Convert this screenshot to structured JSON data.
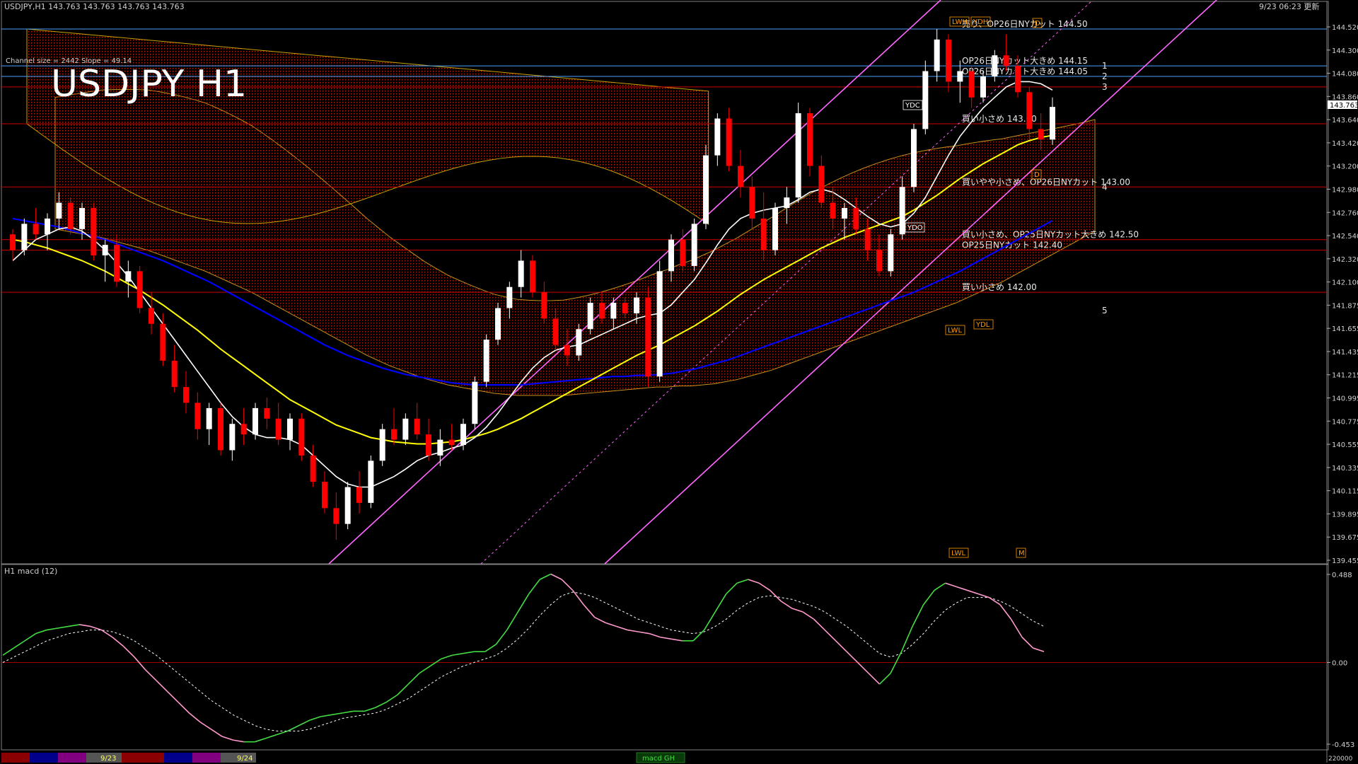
{
  "header": {
    "symbol_info": "USDJPY,H1  143.763 143.763 143.763 143.763",
    "datetime": "9/23 06:23 更新",
    "channel_info": "Channel size = 2442 Slope = 49.14",
    "big_title": "USDJPY H1"
  },
  "subwindow": {
    "title": "H1  macd (12)"
  },
  "bottom_bar": {
    "date1": "9/23",
    "date2": "9/24",
    "center_label": "macd GH"
  },
  "chart_data": {
    "type": "line",
    "title": "USDJPY H1",
    "current_price": "143.763",
    "y_ticks": [
      "144.520",
      "144.300",
      "144.080",
      "143.860",
      "143.640",
      "143.420",
      "143.200",
      "142.980",
      "142.760",
      "142.540",
      "142.320",
      "142.100",
      "141.875",
      "141.655",
      "141.435",
      "141.215",
      "140.995",
      "140.775",
      "140.555",
      "140.335",
      "140.115",
      "139.895",
      "139.675",
      "139.455"
    ],
    "macd_ticks": [
      "0.488",
      "0.00",
      "-0.453"
    ],
    "bottom_right_value": "220000",
    "colors": {
      "bull": "#ffffff",
      "bear": "#ff0000",
      "sma_short": "#ffffff",
      "sma_mid": "#ffff00",
      "sma_long": "#0000ff",
      "channel": "#ff66ff",
      "macd": "#44dd44",
      "macd_down": "#ff99cc",
      "signal": "#ffffff",
      "level": "#cc0000",
      "cloud": "#cc2200"
    },
    "levels": [
      {
        "price": 144.5,
        "text": "売り、OP26日NYカット 144.50",
        "num": ""
      },
      {
        "price": 144.15,
        "text": "OP26日NYカット大きめ 144.15",
        "num": "1"
      },
      {
        "price": 144.05,
        "text": "OP26日NYカット大きめ 144.05",
        "num": "2"
      },
      {
        "price": 143.95,
        "text": "",
        "num": "3"
      },
      {
        "price": 143.6,
        "text": "買い小さめ 143.60",
        "num": ""
      },
      {
        "price": 143.0,
        "text": "買いやや小さめ、OP26日NYカット 143.00",
        "num": "4"
      },
      {
        "price": 142.5,
        "text": "買い小さめ、OP25日NYカット大きめ 142.50",
        "num": ""
      },
      {
        "price": 142.4,
        "text": "OP25日NYカット 142.40",
        "num": ""
      },
      {
        "price": 142.0,
        "text": "買い小さめ 142.00",
        "num": ""
      }
    ],
    "level_number_5": "5",
    "tag_labels": [
      "YDC",
      "YDO",
      "YDL",
      "LWL",
      "LWH",
      "YDH",
      "LWL",
      "M",
      "D",
      "D"
    ],
    "candles": [
      [
        142.55,
        142.6,
        142.3,
        142.4
      ],
      [
        142.4,
        142.7,
        142.35,
        142.65
      ],
      [
        142.65,
        142.8,
        142.5,
        142.55
      ],
      [
        142.55,
        142.75,
        142.4,
        142.7
      ],
      [
        142.7,
        142.95,
        142.6,
        142.85
      ],
      [
        142.85,
        142.9,
        142.55,
        142.6
      ],
      [
        142.6,
        142.85,
        142.5,
        142.8
      ],
      [
        142.8,
        142.85,
        142.3,
        142.35
      ],
      [
        142.35,
        142.5,
        142.1,
        142.45
      ],
      [
        142.45,
        142.55,
        142.05,
        142.1
      ],
      [
        142.1,
        142.3,
        141.95,
        142.2
      ],
      [
        142.2,
        142.25,
        141.8,
        141.85
      ],
      [
        141.85,
        142.0,
        141.6,
        141.7
      ],
      [
        141.7,
        141.8,
        141.3,
        141.35
      ],
      [
        141.35,
        141.5,
        141.05,
        141.1
      ],
      [
        141.1,
        141.25,
        140.85,
        140.95
      ],
      [
        140.95,
        141.05,
        140.6,
        140.7
      ],
      [
        140.7,
        140.95,
        140.55,
        140.9
      ],
      [
        140.9,
        140.95,
        140.45,
        140.5
      ],
      [
        140.5,
        140.8,
        140.4,
        140.75
      ],
      [
        140.75,
        140.9,
        140.55,
        140.65
      ],
      [
        140.65,
        140.95,
        140.6,
        140.9
      ],
      [
        140.9,
        141.0,
        140.7,
        140.8
      ],
      [
        140.8,
        140.95,
        140.55,
        140.6
      ],
      [
        140.6,
        140.85,
        140.5,
        140.8
      ],
      [
        140.8,
        140.85,
        140.4,
        140.45
      ],
      [
        140.45,
        140.55,
        140.15,
        140.2
      ],
      [
        140.2,
        140.3,
        139.9,
        139.95
      ],
      [
        139.95,
        140.1,
        139.65,
        139.8
      ],
      [
        139.8,
        140.2,
        139.75,
        140.15
      ],
      [
        140.15,
        140.3,
        139.9,
        140.0
      ],
      [
        140.0,
        140.45,
        139.95,
        140.4
      ],
      [
        140.4,
        140.75,
        140.35,
        140.7
      ],
      [
        140.7,
        140.9,
        140.55,
        140.6
      ],
      [
        140.6,
        140.85,
        140.55,
        140.8
      ],
      [
        140.8,
        140.95,
        140.6,
        140.65
      ],
      [
        140.65,
        140.8,
        140.4,
        140.45
      ],
      [
        140.45,
        140.7,
        140.35,
        140.6
      ],
      [
        140.6,
        140.75,
        140.5,
        140.55
      ],
      [
        140.55,
        140.8,
        140.5,
        140.75
      ],
      [
        140.75,
        141.2,
        140.7,
        141.15
      ],
      [
        141.15,
        141.6,
        141.1,
        141.55
      ],
      [
        141.55,
        141.9,
        141.5,
        141.85
      ],
      [
        141.85,
        142.1,
        141.75,
        142.05
      ],
      [
        142.05,
        142.4,
        141.95,
        142.3
      ],
      [
        142.3,
        142.35,
        141.95,
        142.0
      ],
      [
        142.0,
        142.1,
        141.7,
        141.75
      ],
      [
        141.75,
        141.85,
        141.45,
        141.5
      ],
      [
        141.5,
        141.65,
        141.3,
        141.4
      ],
      [
        141.4,
        141.7,
        141.35,
        141.65
      ],
      [
        141.65,
        141.95,
        141.6,
        141.9
      ],
      [
        141.9,
        142.0,
        141.7,
        141.75
      ],
      [
        141.75,
        141.95,
        141.65,
        141.9
      ],
      [
        141.9,
        141.95,
        141.75,
        141.8
      ],
      [
        141.8,
        142.0,
        141.7,
        141.95
      ],
      [
        141.95,
        142.05,
        141.1,
        141.2
      ],
      [
        141.2,
        142.3,
        141.15,
        142.2
      ],
      [
        142.2,
        142.55,
        142.1,
        142.5
      ],
      [
        142.5,
        142.6,
        142.2,
        142.25
      ],
      [
        142.25,
        142.7,
        142.2,
        142.65
      ],
      [
        142.65,
        143.4,
        142.6,
        143.3
      ],
      [
        143.3,
        143.7,
        143.2,
        143.65
      ],
      [
        143.65,
        143.75,
        143.15,
        143.2
      ],
      [
        143.2,
        143.35,
        142.9,
        143.0
      ],
      [
        143.0,
        143.1,
        142.6,
        142.7
      ],
      [
        142.7,
        142.95,
        142.3,
        142.4
      ],
      [
        142.4,
        142.85,
        142.35,
        142.8
      ],
      [
        142.8,
        143.0,
        142.65,
        142.9
      ],
      [
        142.9,
        143.8,
        142.85,
        143.7
      ],
      [
        143.7,
        143.75,
        143.1,
        143.2
      ],
      [
        143.2,
        143.3,
        142.8,
        142.85
      ],
      [
        142.85,
        143.0,
        142.6,
        142.7
      ],
      [
        142.7,
        142.85,
        142.5,
        142.8
      ],
      [
        142.8,
        142.9,
        142.55,
        142.6
      ],
      [
        142.6,
        142.7,
        142.3,
        142.4
      ],
      [
        142.4,
        142.55,
        142.15,
        142.2
      ],
      [
        142.2,
        142.6,
        142.15,
        142.55
      ],
      [
        142.55,
        143.1,
        142.5,
        143.0
      ],
      [
        143.0,
        143.6,
        142.95,
        143.55
      ],
      [
        143.55,
        144.2,
        143.5,
        144.1
      ],
      [
        144.1,
        144.5,
        144.0,
        144.4
      ],
      [
        144.4,
        144.45,
        143.9,
        144.0
      ],
      [
        144.0,
        144.2,
        143.8,
        144.1
      ],
      [
        144.1,
        144.15,
        143.75,
        143.85
      ],
      [
        143.85,
        144.1,
        143.8,
        144.05
      ],
      [
        144.05,
        144.3,
        144.0,
        144.25
      ],
      [
        144.25,
        144.45,
        144.1,
        144.15
      ],
      [
        144.15,
        144.25,
        143.85,
        143.9
      ],
      [
        143.9,
        143.95,
        143.45,
        143.55
      ],
      [
        143.55,
        143.7,
        143.35,
        143.45
      ],
      [
        143.45,
        143.85,
        143.4,
        143.76
      ]
    ],
    "sma_short": [
      142.3,
      142.4,
      142.5,
      142.55,
      142.6,
      142.62,
      142.58,
      142.5,
      142.4,
      142.28,
      142.15,
      142.0,
      141.85,
      141.7,
      141.55,
      141.4,
      141.25,
      141.1,
      140.95,
      140.82,
      140.72,
      140.65,
      140.62,
      140.62,
      140.6,
      140.55,
      140.45,
      140.35,
      140.25,
      140.18,
      140.15,
      140.15,
      140.2,
      140.25,
      140.32,
      140.4,
      140.45,
      140.48,
      140.52,
      140.55,
      140.62,
      140.72,
      140.85,
      141.0,
      141.15,
      141.28,
      141.38,
      141.45,
      141.48,
      141.5,
      141.55,
      141.6,
      141.65,
      141.7,
      141.75,
      141.78,
      141.8,
      141.88,
      142.0,
      142.12,
      142.28,
      142.45,
      142.6,
      142.7,
      142.75,
      142.78,
      142.8,
      142.82,
      142.88,
      142.95,
      142.98,
      142.95,
      142.88,
      142.8,
      142.72,
      142.65,
      142.62,
      142.65,
      142.75,
      142.9,
      143.1,
      143.3,
      143.48,
      143.62,
      143.75,
      143.85,
      143.95,
      144.0,
      144.0,
      143.98,
      143.92
    ],
    "sma_mid": [
      142.5,
      142.48,
      142.45,
      142.42,
      142.38,
      142.34,
      142.3,
      142.25,
      142.2,
      142.14,
      142.08,
      142.02,
      141.95,
      141.88,
      141.8,
      141.72,
      141.64,
      141.55,
      141.46,
      141.38,
      141.3,
      141.22,
      141.14,
      141.06,
      140.98,
      140.92,
      140.86,
      140.8,
      140.74,
      140.7,
      140.66,
      140.62,
      140.6,
      140.58,
      140.57,
      140.56,
      140.56,
      140.57,
      140.58,
      140.6,
      140.63,
      140.66,
      140.7,
      140.75,
      140.8,
      140.86,
      140.92,
      140.98,
      141.04,
      141.1,
      141.16,
      141.22,
      141.28,
      141.34,
      141.4,
      141.45,
      141.5,
      141.56,
      141.62,
      141.68,
      141.75,
      141.82,
      141.9,
      141.98,
      142.05,
      142.12,
      142.18,
      142.24,
      142.3,
      142.36,
      142.42,
      142.47,
      142.52,
      142.56,
      142.6,
      142.64,
      142.68,
      142.72,
      142.78,
      142.85,
      142.92,
      143.0,
      143.08,
      143.15,
      143.22,
      143.28,
      143.34,
      143.4,
      143.44,
      143.47,
      143.49
    ],
    "sma_long": [
      142.7,
      142.68,
      142.66,
      142.64,
      142.62,
      142.59,
      142.56,
      142.53,
      142.5,
      142.46,
      142.42,
      142.38,
      142.34,
      142.3,
      142.25,
      142.2,
      142.15,
      142.1,
      142.04,
      141.98,
      141.92,
      141.86,
      141.8,
      141.74,
      141.68,
      141.62,
      141.56,
      141.5,
      141.45,
      141.4,
      141.36,
      141.32,
      141.28,
      141.25,
      141.22,
      141.2,
      141.18,
      141.16,
      141.14,
      141.13,
      141.12,
      141.12,
      141.12,
      141.12,
      141.12,
      141.13,
      141.14,
      141.15,
      141.16,
      141.17,
      141.18,
      141.19,
      141.2,
      141.2,
      141.21,
      141.21,
      141.22,
      141.23,
      141.25,
      141.27,
      141.3,
      141.33,
      141.36,
      141.4,
      141.44,
      141.48,
      141.52,
      141.56,
      141.6,
      141.64,
      141.68,
      141.72,
      141.76,
      141.8,
      141.84,
      141.88,
      141.92,
      141.96,
      142.0,
      142.05,
      142.1,
      142.15,
      142.2,
      142.26,
      142.32,
      142.38,
      142.44,
      142.5,
      142.56,
      142.62,
      142.68
    ],
    "macd": [
      0.04,
      0.08,
      0.12,
      0.16,
      0.18,
      0.19,
      0.2,
      0.21,
      0.2,
      0.18,
      0.14,
      0.09,
      0.03,
      -0.04,
      -0.1,
      -0.16,
      -0.22,
      -0.28,
      -0.33,
      -0.37,
      -0.41,
      -0.43,
      -0.44,
      -0.44,
      -0.42,
      -0.4,
      -0.38,
      -0.35,
      -0.32,
      -0.3,
      -0.29,
      -0.28,
      -0.27,
      -0.27,
      -0.25,
      -0.22,
      -0.18,
      -0.12,
      -0.06,
      -0.02,
      0.02,
      0.04,
      0.05,
      0.06,
      0.06,
      0.1,
      0.18,
      0.28,
      0.38,
      0.46,
      0.49,
      0.46,
      0.4,
      0.32,
      0.25,
      0.22,
      0.2,
      0.18,
      0.17,
      0.16,
      0.14,
      0.13,
      0.12,
      0.12,
      0.18,
      0.28,
      0.38,
      0.44,
      0.46,
      0.44,
      0.4,
      0.34,
      0.3,
      0.28,
      0.24,
      0.18,
      0.12,
      0.06,
      0.0,
      -0.06,
      -0.12,
      -0.06,
      0.06,
      0.2,
      0.32,
      0.4,
      0.44,
      0.42,
      0.4,
      0.38,
      0.36,
      0.32,
      0.24,
      0.14,
      0.08,
      0.06
    ],
    "signal": [
      0.0,
      0.03,
      0.06,
      0.09,
      0.12,
      0.14,
      0.16,
      0.17,
      0.18,
      0.18,
      0.17,
      0.15,
      0.12,
      0.08,
      0.04,
      -0.01,
      -0.06,
      -0.11,
      -0.16,
      -0.21,
      -0.25,
      -0.29,
      -0.32,
      -0.35,
      -0.37,
      -0.38,
      -0.38,
      -0.38,
      -0.37,
      -0.35,
      -0.33,
      -0.31,
      -0.3,
      -0.29,
      -0.28,
      -0.26,
      -0.23,
      -0.2,
      -0.16,
      -0.12,
      -0.08,
      -0.05,
      -0.02,
      0.0,
      0.02,
      0.04,
      0.08,
      0.13,
      0.19,
      0.26,
      0.32,
      0.37,
      0.39,
      0.38,
      0.36,
      0.33,
      0.3,
      0.27,
      0.24,
      0.22,
      0.2,
      0.18,
      0.17,
      0.16,
      0.17,
      0.2,
      0.24,
      0.29,
      0.33,
      0.36,
      0.37,
      0.36,
      0.35,
      0.33,
      0.31,
      0.28,
      0.24,
      0.2,
      0.15,
      0.1,
      0.05,
      0.03,
      0.05,
      0.1,
      0.16,
      0.23,
      0.29,
      0.33,
      0.36,
      0.36,
      0.36,
      0.34,
      0.31,
      0.27,
      0.23,
      0.2
    ]
  }
}
